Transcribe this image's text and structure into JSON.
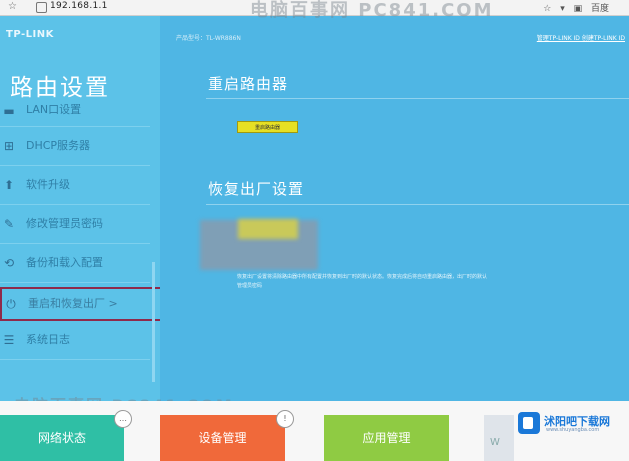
{
  "browser": {
    "url": "192.168.1.1",
    "icons": {
      "star": "star-icon",
      "shield": "shield-icon",
      "bookmark": "bookmark-icon"
    },
    "menu_label": "百度"
  },
  "sidebar": {
    "logo": "TP-LINK",
    "title": "路由设置",
    "items": [
      {
        "label": "LAN口设置",
        "icon": "lan-icon"
      },
      {
        "label": "DHCP服务器",
        "icon": "dhcp-icon"
      },
      {
        "label": "软件升级",
        "icon": "upgrade-icon"
      },
      {
        "label": "修改管理员密码",
        "icon": "lock-icon"
      },
      {
        "label": "备份和载入配置",
        "icon": "backup-icon"
      },
      {
        "label": "重启和恢复出厂 >",
        "icon": "power-icon"
      },
      {
        "label": "系统日志",
        "icon": "log-icon"
      }
    ]
  },
  "main": {
    "device_info": "产品型号：TL-WR886N",
    "top_links": "管理TP-LINK ID  创建TP-LINK ID",
    "reboot": {
      "title": "重启路由器",
      "button_label": "重启路由器"
    },
    "reset": {
      "title": "恢复出厂设置",
      "note_line1": "恢复出厂设置将清除路由器中所有配置并恢复到出厂时的默认状态。恢复完成后将自动重启路由器，出厂时的默认",
      "note_line2": "管理员密码"
    }
  },
  "watermarks": {
    "top": "电脑百事网 PC841.COM",
    "bottom": "电脑百事网 PC841.COM"
  },
  "bottom": {
    "tiles": [
      {
        "label": "网络状态"
      },
      {
        "label": "设备管理"
      },
      {
        "label": "应用管理"
      }
    ],
    "badge_network": "…",
    "badge_device": "!"
  },
  "site_badge": {
    "name": "沭阳吧下载网",
    "sub": "www.shuyangba.com"
  },
  "colors": {
    "main_bg": "#4fb6e4",
    "sidebar_bg": "#5cc2e8",
    "button_yellow": "#e6e024",
    "active_border": "#8f2a4a",
    "tile_network": "#2fbfa5",
    "tile_device": "#f0693a",
    "tile_app": "#8fcb43"
  }
}
